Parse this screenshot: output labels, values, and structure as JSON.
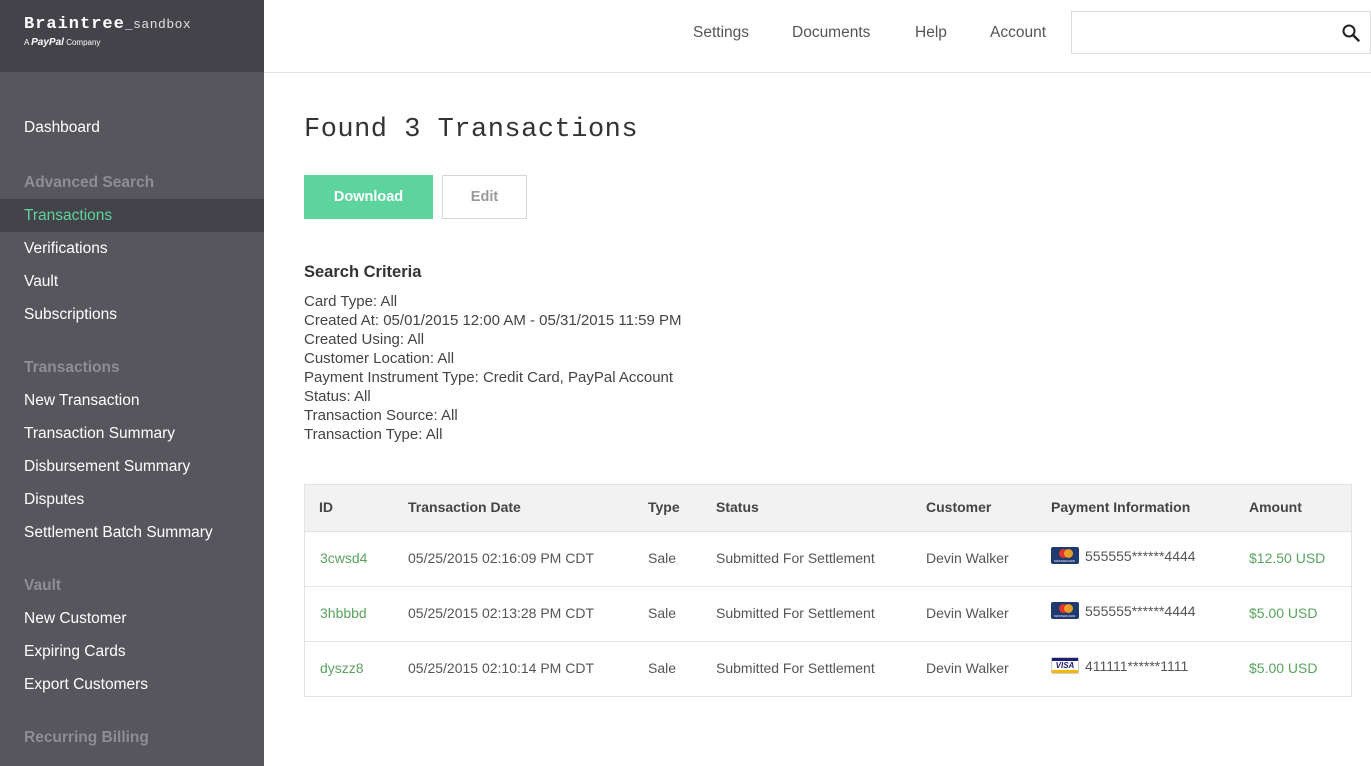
{
  "brand": {
    "name": "Braintree",
    "suffix": "_sandbox",
    "sub_prefix": "A",
    "sub_paypal": "PayPal",
    "sub_suffix": "Company"
  },
  "sidebar": {
    "items": [
      {
        "label": "Dashboard"
      },
      {
        "heading": "Advanced Search"
      },
      {
        "label": "Transactions",
        "active": true
      },
      {
        "label": "Verifications"
      },
      {
        "label": "Vault"
      },
      {
        "label": "Subscriptions"
      },
      {
        "heading": "Transactions"
      },
      {
        "label": "New Transaction"
      },
      {
        "label": "Transaction Summary"
      },
      {
        "label": "Disbursement Summary"
      },
      {
        "label": "Disputes"
      },
      {
        "label": "Settlement Batch Summary"
      },
      {
        "heading": "Vault"
      },
      {
        "label": "New Customer"
      },
      {
        "label": "Expiring Cards"
      },
      {
        "label": "Export Customers"
      },
      {
        "heading": "Recurring Billing"
      }
    ]
  },
  "topnav": {
    "settings": "Settings",
    "documents": "Documents",
    "help": "Help",
    "account": "Account",
    "search_value": "",
    "search_icon": "search-icon"
  },
  "main": {
    "title": "Found 3 Transactions",
    "download_label": "Download",
    "edit_label": "Edit",
    "criteria_title": "Search Criteria",
    "criteria": [
      "Card Type: All",
      "Created At: 05/01/2015 12:00 AM - 05/31/2015 11:59 PM",
      "Created Using: All",
      "Customer Location: All",
      "Payment Instrument Type: Credit Card, PayPal Account",
      "Status: All",
      "Transaction Source: All",
      "Transaction Type: All"
    ]
  },
  "table": {
    "headers": {
      "id": "ID",
      "date": "Transaction Date",
      "type": "Type",
      "status": "Status",
      "customer": "Customer",
      "payment": "Payment Information",
      "amount": "Amount"
    },
    "rows": [
      {
        "id": "3cwsd4",
        "date": "05/25/2015 02:16:09 PM CDT",
        "type": "Sale",
        "status": "Submitted For Settlement",
        "customer": "Devin Walker",
        "card": "mastercard",
        "card_label": "MASTERCARD",
        "payment": "555555******4444",
        "amount": "$12.50 USD"
      },
      {
        "id": "3hbbbd",
        "date": "05/25/2015 02:13:28 PM CDT",
        "type": "Sale",
        "status": "Submitted For Settlement",
        "customer": "Devin Walker",
        "card": "mastercard",
        "card_label": "MASTERCARD",
        "payment": "555555******4444",
        "amount": "$5.00 USD"
      },
      {
        "id": "dyszz8",
        "date": "05/25/2015 02:10:14 PM CDT",
        "type": "Sale",
        "status": "Submitted For Settlement",
        "customer": "Devin Walker",
        "card": "visa",
        "card_label": "VISA",
        "payment": "411111******1111",
        "amount": "$5.00 USD"
      }
    ]
  },
  "colors": {
    "accent": "#5dd39e",
    "sidebar": "#57565c",
    "sidebar_dark": "#444349",
    "link": "#5aa35f"
  }
}
